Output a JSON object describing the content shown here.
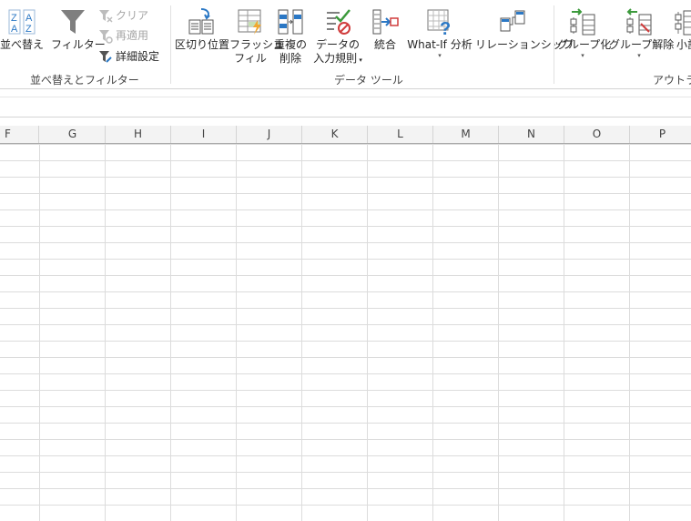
{
  "ribbon": {
    "sort_label": "並べ替え",
    "filter_label": "フィルター",
    "clear_label": "クリア",
    "reapply_label": "再適用",
    "advanced_label": "詳細設定",
    "sort_filter_group": "並べ替えとフィルター",
    "text_to_columns_label": "区切り位置",
    "flash_fill_label_1": "フラッシュ",
    "flash_fill_label_2": "フィル",
    "remove_dup_label_1": "重複の",
    "remove_dup_label_2": "削除",
    "validation_label_1": "データの",
    "validation_label_2": "入力規則",
    "consolidate_label": "統合",
    "whatif_label": "What-If 分析",
    "relationships_label": "リレーションシップ",
    "data_tools_group": "データ ツール",
    "group_label": "グループ化",
    "ungroup_label": "グループ解除",
    "subtotal_label": "小計",
    "outline_group": "アウトライン"
  },
  "columns": [
    "F",
    "G",
    "H",
    "I",
    "J",
    "K",
    "L",
    "M",
    "N",
    "O",
    "P"
  ],
  "colors": {
    "accent_blue": "#2b78c5",
    "disabled": "#a6a6a6",
    "grid_line": "#dcdcdc",
    "header_bg": "#f3f3f3"
  }
}
